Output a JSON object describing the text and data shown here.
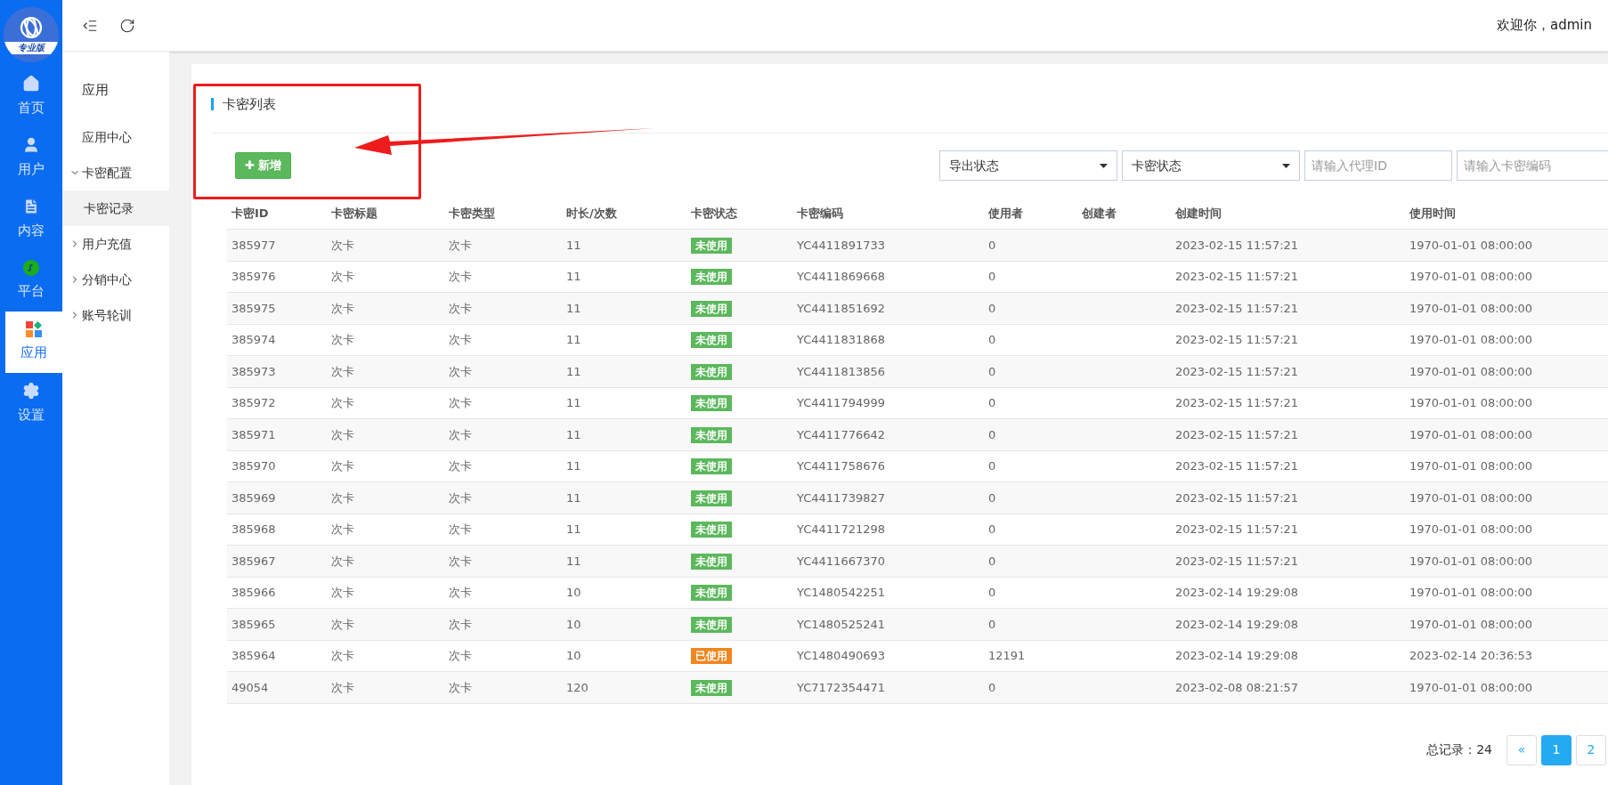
{
  "logo": {
    "badge": "专业版"
  },
  "nav": [
    {
      "kind": "home",
      "label": "首页",
      "selected": false
    },
    {
      "kind": "user",
      "label": "用户",
      "selected": false
    },
    {
      "kind": "doc",
      "label": "内容",
      "selected": false
    },
    {
      "kind": "platform",
      "label": "平台",
      "selected": false
    },
    {
      "kind": "apps",
      "label": "应用",
      "selected": true
    },
    {
      "kind": "settings",
      "label": "设置",
      "selected": false
    }
  ],
  "header": {
    "welcome": "欢迎你，admin"
  },
  "submenu": {
    "title": "应用",
    "items": [
      {
        "label": "应用中心",
        "selected": false
      },
      {
        "label": "卡密配置",
        "expanded": true,
        "selected": false,
        "children": [
          {
            "label": "卡密记录",
            "selected": true
          }
        ]
      },
      {
        "label": "用户充值",
        "expanded": false,
        "selected": false
      },
      {
        "label": "分销中心",
        "expanded": false,
        "selected": false
      },
      {
        "label": "账号轮训",
        "expanded": false,
        "selected": false
      }
    ]
  },
  "card": {
    "title": "卡密列表",
    "add_button": "✚ 新增"
  },
  "filters": [
    {
      "kind": "select",
      "value": "导出状态"
    },
    {
      "kind": "select",
      "value": "卡密状态"
    },
    {
      "kind": "input",
      "placeholder": "请输入代理ID"
    },
    {
      "kind": "input",
      "placeholder": "请输入卡密编码"
    }
  ],
  "table": {
    "columns": [
      "卡密ID",
      "卡密标题",
      "卡密类型",
      "时长/次数",
      "卡密状态",
      "卡密编码",
      "使用者",
      "创建者",
      "创建时间",
      "使用时间"
    ],
    "rows": [
      {
        "id": "385977",
        "title": "次卡",
        "type": "次卡",
        "amount": "11",
        "status": "未使用",
        "used": false,
        "code": "YC4411891733",
        "user": "0",
        "created": "2023-02-15 11:57:21",
        "used_at": "1970-01-01 08:00:00"
      },
      {
        "id": "385976",
        "title": "次卡",
        "type": "次卡",
        "amount": "11",
        "status": "未使用",
        "used": false,
        "code": "YC4411869668",
        "user": "0",
        "created": "2023-02-15 11:57:21",
        "used_at": "1970-01-01 08:00:00"
      },
      {
        "id": "385975",
        "title": "次卡",
        "type": "次卡",
        "amount": "11",
        "status": "未使用",
        "used": false,
        "code": "YC4411851692",
        "user": "0",
        "created": "2023-02-15 11:57:21",
        "used_at": "1970-01-01 08:00:00"
      },
      {
        "id": "385974",
        "title": "次卡",
        "type": "次卡",
        "amount": "11",
        "status": "未使用",
        "used": false,
        "code": "YC4411831868",
        "user": "0",
        "created": "2023-02-15 11:57:21",
        "used_at": "1970-01-01 08:00:00"
      },
      {
        "id": "385973",
        "title": "次卡",
        "type": "次卡",
        "amount": "11",
        "status": "未使用",
        "used": false,
        "code": "YC4411813856",
        "user": "0",
        "created": "2023-02-15 11:57:21",
        "used_at": "1970-01-01 08:00:00"
      },
      {
        "id": "385972",
        "title": "次卡",
        "type": "次卡",
        "amount": "11",
        "status": "未使用",
        "used": false,
        "code": "YC4411794999",
        "user": "0",
        "created": "2023-02-15 11:57:21",
        "used_at": "1970-01-01 08:00:00"
      },
      {
        "id": "385971",
        "title": "次卡",
        "type": "次卡",
        "amount": "11",
        "status": "未使用",
        "used": false,
        "code": "YC4411776642",
        "user": "0",
        "created": "2023-02-15 11:57:21",
        "used_at": "1970-01-01 08:00:00"
      },
      {
        "id": "385970",
        "title": "次卡",
        "type": "次卡",
        "amount": "11",
        "status": "未使用",
        "used": false,
        "code": "YC4411758676",
        "user": "0",
        "created": "2023-02-15 11:57:21",
        "used_at": "1970-01-01 08:00:00"
      },
      {
        "id": "385969",
        "title": "次卡",
        "type": "次卡",
        "amount": "11",
        "status": "未使用",
        "used": false,
        "code": "YC4411739827",
        "user": "0",
        "created": "2023-02-15 11:57:21",
        "used_at": "1970-01-01 08:00:00"
      },
      {
        "id": "385968",
        "title": "次卡",
        "type": "次卡",
        "amount": "11",
        "status": "未使用",
        "used": false,
        "code": "YC4411721298",
        "user": "0",
        "created": "2023-02-15 11:57:21",
        "used_at": "1970-01-01 08:00:00"
      },
      {
        "id": "385967",
        "title": "次卡",
        "type": "次卡",
        "amount": "11",
        "status": "未使用",
        "used": false,
        "code": "YC4411667370",
        "user": "0",
        "created": "2023-02-15 11:57:21",
        "used_at": "1970-01-01 08:00:00"
      },
      {
        "id": "385966",
        "title": "次卡",
        "type": "次卡",
        "amount": "10",
        "status": "未使用",
        "used": false,
        "code": "YC1480542251",
        "user": "0",
        "created": "2023-02-14 19:29:08",
        "used_at": "1970-01-01 08:00:00"
      },
      {
        "id": "385965",
        "title": "次卡",
        "type": "次卡",
        "amount": "10",
        "status": "未使用",
        "used": false,
        "code": "YC1480525241",
        "user": "0",
        "created": "2023-02-14 19:29:08",
        "used_at": "1970-01-01 08:00:00"
      },
      {
        "id": "385964",
        "title": "次卡",
        "type": "次卡",
        "amount": "10",
        "status": "已使用",
        "used": true,
        "code": "YC1480490693",
        "user": "12191",
        "created": "2023-02-14 19:29:08",
        "used_at": "2023-02-14 20:36:53"
      },
      {
        "id": "49054",
        "title": "次卡",
        "type": "次卡",
        "amount": "120",
        "status": "未使用",
        "used": false,
        "code": "YC7172354471",
        "user": "0",
        "created": "2023-02-08 08:21:57",
        "used_at": "1970-01-01 08:00:00"
      }
    ]
  },
  "pagination": {
    "total": "总记录：24",
    "pages": [
      {
        "label": "«",
        "selected": false
      },
      {
        "label": "1",
        "selected": true
      },
      {
        "label": "2",
        "selected": false
      }
    ]
  }
}
